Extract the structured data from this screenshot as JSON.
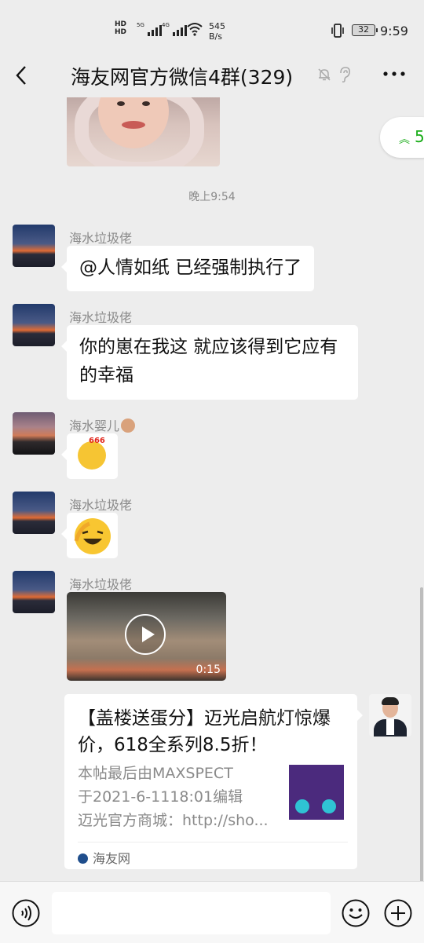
{
  "status_bar": {
    "hd1": "HD",
    "hd2": "HD",
    "net1": "5G",
    "net2": "4G",
    "speed_value": "545",
    "speed_unit": "B/s",
    "battery": "32",
    "time": "9:59"
  },
  "header": {
    "title": "海友网官方微信4群(329)"
  },
  "unread_jump": {
    "count": "5"
  },
  "timestamp": "晚上9:54",
  "messages": [
    {
      "sender": "海水垃圾佬",
      "text": "@人情如纸  已经强制执行了"
    },
    {
      "sender": "海水垃圾佬",
      "text": "你的崽在我这 就应该得到它应有的幸福"
    },
    {
      "sender": "海水婴儿",
      "sticker": "666"
    },
    {
      "sender": "海水垃圾佬",
      "sticker": "laughing-face"
    },
    {
      "sender": "海水垃圾佬",
      "video_duration": "0:15"
    }
  ],
  "link_card": {
    "title": "【盖楼送蛋分】迈光启航灯惊爆价，618全系列8.5折！",
    "desc_line1": "本帖最后由MAXSPECT",
    "desc_line2": "于2021-6-1118:01编辑",
    "desc_line3": "迈光官方商城：http://sho...",
    "source": "海友网"
  },
  "colors": {
    "background": "#ededed",
    "bubble": "#ffffff",
    "accent_green": "#1aad19",
    "meta_text": "#8a8a8a"
  },
  "icons": [
    "back-arrow-icon",
    "mute-bell-icon",
    "earpiece-icon",
    "more-icon",
    "voice-icon",
    "emoji-icon",
    "plus-icon",
    "play-icon"
  ]
}
